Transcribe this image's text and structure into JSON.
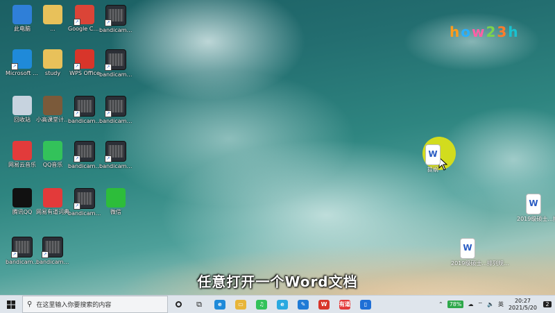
{
  "desktop": {
    "icons": [
      {
        "id": "computer",
        "label": "此电脑",
        "color": "#2f7fd8"
      },
      {
        "id": "folder-unnamed",
        "label": "...",
        "color": "#e8c15a"
      },
      {
        "id": "chrome",
        "label": "Google Chrome",
        "color": "#db4437"
      },
      {
        "id": "bandicam-1",
        "label": "bandicam 2021-05-...",
        "color": "#2b2f36"
      },
      {
        "id": "edge",
        "label": "Microsoft Edge",
        "color": "#1f8ad9"
      },
      {
        "id": "study",
        "label": "study",
        "color": "#e8c15a"
      },
      {
        "id": "wps",
        "label": "WPS Office",
        "color": "#d8352a"
      },
      {
        "id": "bandicam-2",
        "label": "bandicam 2021-05-...",
        "color": "#2b2f36"
      },
      {
        "id": "recycle-bin",
        "label": "回收站",
        "color": "#c7d3df"
      },
      {
        "id": "xiaogao",
        "label": "小高课堂计算机二级WPS...",
        "color": "#7b5a3a"
      },
      {
        "id": "bandicam-3",
        "label": "bandicam 2021-05-...",
        "color": "#2b2f36"
      },
      {
        "id": "bandicam-4",
        "label": "bandicam 2021-05-...",
        "color": "#2b2f36"
      },
      {
        "id": "netease-music",
        "label": "网易云音乐",
        "color": "#e23b3b"
      },
      {
        "id": "qq-music",
        "label": "QQ音乐",
        "color": "#33c25a"
      },
      {
        "id": "bandicam-5",
        "label": "bandicam 2021-05-...",
        "color": "#2b2f36"
      },
      {
        "id": "bandicam-6",
        "label": "bandicam 2021-05-...",
        "color": "#2b2f36"
      },
      {
        "id": "qq",
        "label": "腾讯QQ",
        "color": "#111111"
      },
      {
        "id": "youdao",
        "label": "网易有道词典",
        "color": "#e33a3a"
      },
      {
        "id": "bandicam-7",
        "label": "bandicam 2021-05-...",
        "color": "#2b2f36"
      },
      {
        "id": "wechat",
        "label": "微信",
        "color": "#2dbd3a"
      },
      {
        "id": "bandicam-8",
        "label": "bandicam 2021-05-...",
        "color": "#2b2f36"
      },
      {
        "id": "bandicam-9",
        "label": "bandicam 2021-05-...",
        "color": "#2b2f36"
      }
    ],
    "right_docs": [
      {
        "id": "doc-outline",
        "label": "提纲"
      },
      {
        "id": "doc-2019-1",
        "label": "2019级硕士...排列规..."
      },
      {
        "id": "doc-2019-2",
        "label": "2019级硕士...排列规..."
      }
    ],
    "logo": [
      "h",
      "o",
      "w",
      "2",
      "3",
      "h"
    ],
    "subtitle": "任意打开一个Word文档",
    "highlight_color": "#d2dc1e"
  },
  "taskbar": {
    "search_placeholder": "在这里输入你要搜索的内容",
    "apps": [
      {
        "id": "edge",
        "glyph": "e",
        "color": "#1f8ad9"
      },
      {
        "id": "explorer",
        "glyph": "▭",
        "color": "#e8b53a"
      },
      {
        "id": "qq-music",
        "glyph": "♫",
        "color": "#33c25a"
      },
      {
        "id": "ie",
        "glyph": "e",
        "color": "#2aa9e0"
      },
      {
        "id": "paint",
        "glyph": "✎",
        "color": "#1f7bd6"
      },
      {
        "id": "wps",
        "glyph": "W",
        "color": "#d8352a"
      },
      {
        "id": "youdao",
        "glyph": "有道",
        "color": "#e33a3a"
      },
      {
        "id": "phone",
        "glyph": "▯",
        "color": "#1f6fd6"
      }
    ],
    "battery": "78%",
    "ime": "英",
    "time": "20:27",
    "date": "2021/5/20",
    "notifications": "2"
  }
}
